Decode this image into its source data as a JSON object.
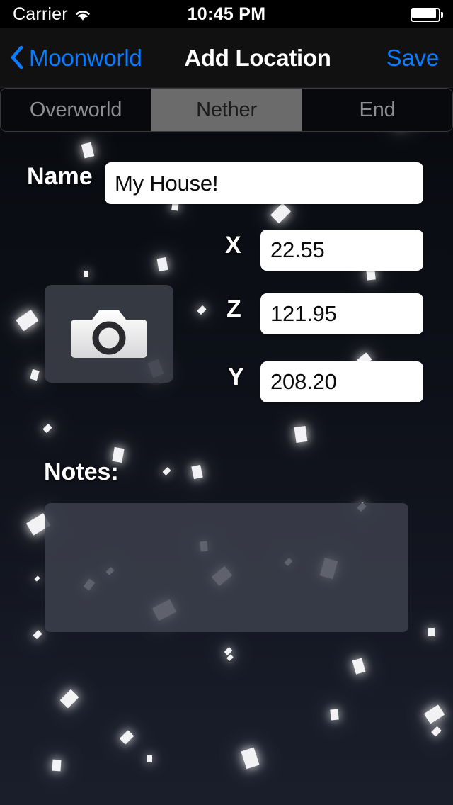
{
  "status_bar": {
    "carrier": "Carrier",
    "wifi_icon": "wifi-icon",
    "time": "10:45 PM",
    "battery_icon": "battery-full-icon"
  },
  "nav_bar": {
    "back_icon": "chevron-left-icon",
    "back_label": "Moonworld",
    "title": "Add Location",
    "save_label": "Save"
  },
  "segmented_control": {
    "segments": [
      {
        "label": "Overworld",
        "selected": false
      },
      {
        "label": "Nether",
        "selected": true
      },
      {
        "label": "End",
        "selected": false
      }
    ]
  },
  "form": {
    "name": {
      "label": "Name",
      "value": "My House!",
      "placeholder": ""
    },
    "x": {
      "label": "X",
      "value": "22.55",
      "placeholder": ""
    },
    "z": {
      "label": "Z",
      "value": "121.95",
      "placeholder": ""
    },
    "y": {
      "label": "Y",
      "value": "208.20",
      "placeholder": ""
    },
    "camera": {
      "icon": "camera-icon"
    },
    "notes": {
      "label": "Notes:",
      "value": "",
      "placeholder": ""
    }
  },
  "colors": {
    "accent_blue": "#0a7cff",
    "background_top": "#07090d",
    "background_bottom": "#1a1e2b",
    "selected_segment": "#6b6b6b",
    "field_background": "#ffffff",
    "notes_background": "#3e424e"
  }
}
